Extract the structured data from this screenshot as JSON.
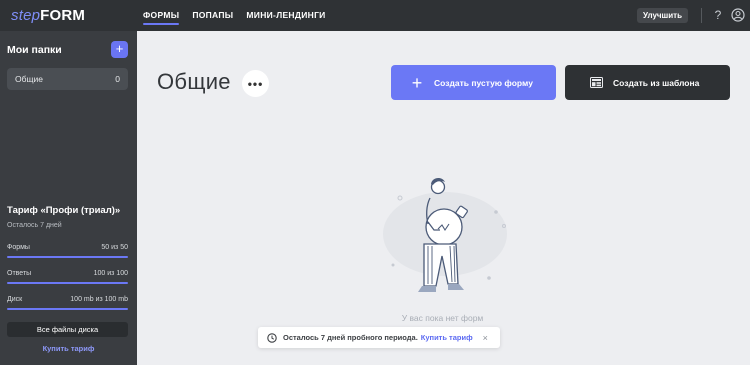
{
  "logo": {
    "part1": "step",
    "part2": "FORM"
  },
  "nav": {
    "tabs": [
      {
        "label": "ФОРМЫ"
      },
      {
        "label": "ПОПАПЫ"
      },
      {
        "label": "МИНИ-ЛЕНДИНГИ"
      }
    ]
  },
  "topbar": {
    "upgrade_label": "Улучшить",
    "help_glyph": "?"
  },
  "sidebar": {
    "title": "Мои папки",
    "add_glyph": "+",
    "folders": [
      {
        "name": "Общие",
        "count": "0"
      }
    ],
    "plan": {
      "title": "Тариф «Профи (триал)»",
      "remaining": "Осталось 7 дней",
      "usage": [
        {
          "label": "Формы",
          "value": "50 из 50",
          "fraction": 1.0
        },
        {
          "label": "Ответы",
          "value": "100 из 100",
          "fraction": 1.0
        },
        {
          "label": "Диск",
          "value": "100 mb из 100 mb",
          "fraction": 1.0
        }
      ]
    },
    "disk_files_label": "Все файлы диска",
    "buy_label": "Купить тариф"
  },
  "main": {
    "folder_title": "Общие",
    "more_glyph": "•••",
    "create_label": "Создать пустую форму",
    "create_glyph": "+",
    "template_label": "Создать из шаблона",
    "empty_text": "У вас пока нет форм"
  },
  "notice": {
    "message": "Осталось 7 дней пробного периода.",
    "link": "Купить тариф",
    "close_glyph": "×"
  },
  "colors": {
    "accent": "#6b78f5",
    "topbar": "#2f3235",
    "sidebar": "#3a3d41",
    "background": "#edeef1"
  },
  "icons": [
    "plus-icon",
    "more-icon",
    "template-icon",
    "help-icon",
    "user-icon",
    "clock-icon",
    "close-icon"
  ]
}
